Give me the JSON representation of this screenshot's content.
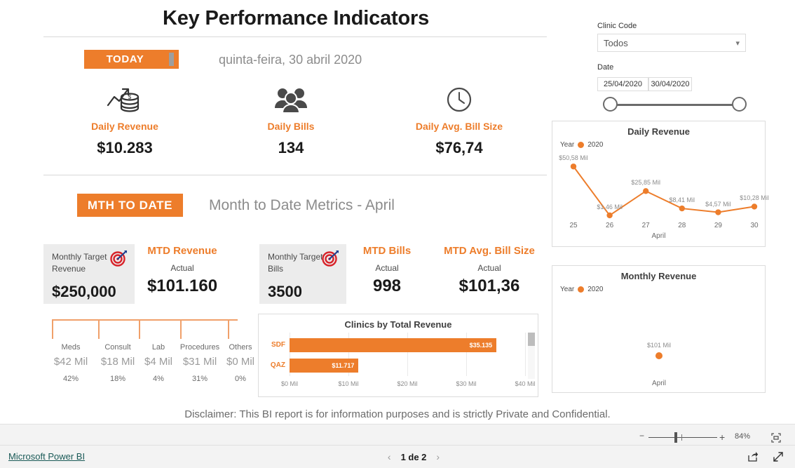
{
  "report": {
    "title": "Key Performance Indicators",
    "disclaimer": "Disclaimer: This BI report is for information purposes and is strictly Private and Confidential.",
    "accent_color": "#ED7D2B",
    "today_badge": "TODAY",
    "date_headline": "quinta-feira, 30 abril 2020",
    "mtd_badge": "MTH TO DATE",
    "mtd_headline": "Month to Date Metrics - April"
  },
  "daily_kpis": [
    {
      "icon": "revenue-coins-icon",
      "label": "Daily Revenue",
      "value": "$10.283"
    },
    {
      "icon": "people-group-icon",
      "label": "Daily Bills",
      "value": "134"
    },
    {
      "icon": "clock-icon",
      "label": "Daily Avg. Bill Size",
      "value": "$76,74"
    }
  ],
  "mtd": {
    "target_revenue": {
      "icon": "target-dart-icon",
      "label_line1": "Monthly Target",
      "label_line2": "Revenue",
      "value": "$250,000"
    },
    "target_bills": {
      "icon": "target-dart-icon",
      "label_line1": "Monthly Target",
      "label_line2": "Bills",
      "value": "3500"
    },
    "revenue": {
      "label": "MTD Revenue",
      "actual_label": "Actual",
      "value": "$101.160"
    },
    "bills": {
      "label": "MTD Bills",
      "actual_label": "Actual",
      "value": "998"
    },
    "avg": {
      "label": "MTD Avg. Bill Size",
      "actual_label": "Actual",
      "value": "$101,36"
    }
  },
  "breakdown": {
    "columns": [
      {
        "name": "Meds",
        "value": "$42 Mil",
        "pct": "42%"
      },
      {
        "name": "Consult",
        "value": "$18 Mil",
        "pct": "18%"
      },
      {
        "name": "Lab",
        "value": "$4 Mil",
        "pct": "4%"
      },
      {
        "name": "Procedures",
        "value": "$31 Mil",
        "pct": "31%"
      },
      {
        "name": "Others",
        "value": "$0 Mil",
        "pct": "0%"
      }
    ]
  },
  "filters": {
    "clinic_code": {
      "label": "Clinic Code",
      "value": "Todos",
      "chevron": "chevron-down-icon"
    },
    "date": {
      "label": "Date",
      "from": "25/04/2020",
      "to": "30/04/2020"
    }
  },
  "chart_data": [
    {
      "id": "clinics",
      "type": "bar",
      "orientation": "horizontal",
      "title": "Clinics by Total Revenue",
      "categories": [
        "SDF",
        "QAZ"
      ],
      "values": [
        35.135,
        11.717
      ],
      "data_labels": [
        "$35.135",
        "$11.717"
      ],
      "xlabel": "",
      "ylabel": "",
      "xlim": [
        0,
        40
      ],
      "xticks": [
        "$0 Mil",
        "$10 Mil",
        "$20 Mil",
        "$30 Mil",
        "$40 Mil"
      ],
      "grid": true,
      "legend": "none",
      "bar_color": "#ED7D2B",
      "scrollable": true
    },
    {
      "id": "daily-revenue",
      "type": "line",
      "title": "Daily Revenue",
      "legend_title": "Year",
      "legend": [
        "2020"
      ],
      "legend_position": "top-left",
      "x": [
        "25",
        "26",
        "27",
        "28",
        "29",
        "30"
      ],
      "values": [
        50.58,
        1.46,
        25.85,
        8.41,
        4.57,
        10.28
      ],
      "data_labels": [
        "$50,58 Mil",
        "$1,46 Mil",
        "$25,85 Mil",
        "$8,41 Mil",
        "$4,57 Mil",
        "$10,28 Mil"
      ],
      "xlabel": "April",
      "ylabel": "",
      "ylim": [
        0,
        55
      ],
      "grid": false,
      "series_color": "#ED7D2B"
    },
    {
      "id": "monthly-revenue",
      "type": "scatter",
      "title": "Monthly Revenue",
      "legend_title": "Year",
      "legend": [
        "2020"
      ],
      "legend_position": "top-left",
      "x": [
        "April"
      ],
      "values": [
        101
      ],
      "data_labels": [
        "$101 Mil"
      ],
      "xlabel": "April",
      "ylabel": "",
      "grid": false,
      "series_color": "#ED7D2B"
    }
  ],
  "statusbar": {
    "zoom_minus": "−",
    "zoom_plus": "+",
    "zoom_level": "84%",
    "fit_icon": "fit-to-page-icon"
  },
  "footer": {
    "brand": "Microsoft Power BI",
    "prev_icon": "chevron-left-icon",
    "next_icon": "chevron-right-icon",
    "page": "1 de 2",
    "share_icon": "share-icon",
    "expand_icon": "expand-icon"
  }
}
